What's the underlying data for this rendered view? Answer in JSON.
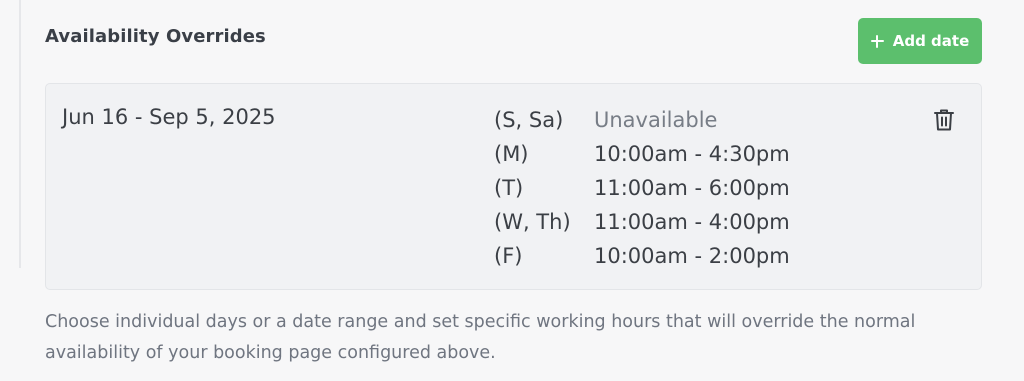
{
  "section": {
    "title": "Availability Overrides",
    "add_button_label": "Add date",
    "add_button_icon": "plus-icon",
    "accent_color": "#5cbf6d"
  },
  "override": {
    "date_range": "Jun 16 - Sep 5, 2025",
    "delete_icon": "trash-icon",
    "schedule": [
      {
        "days": "(S, Sa)",
        "hours": "Unavailable"
      },
      {
        "days": "(M)",
        "hours": "10:00am - 4:30pm"
      },
      {
        "days": "(T)",
        "hours": "11:00am - 6:00pm"
      },
      {
        "days": "(W, Th)",
        "hours": "11:00am - 4:00pm"
      },
      {
        "days": "(F)",
        "hours": "10:00am - 2:00pm"
      }
    ]
  },
  "help_text": "Choose individual days or a date range and set specific working hours that will override the normal availability of your booking page configured above."
}
